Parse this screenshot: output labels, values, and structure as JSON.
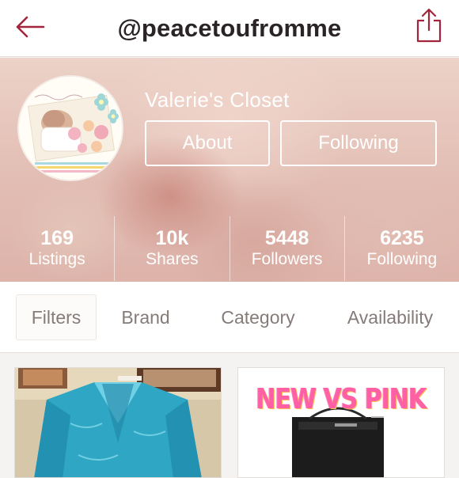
{
  "header": {
    "title": "@peacetoufromme",
    "back_icon": "back-arrow-icon",
    "share_icon": "share-icon"
  },
  "profile": {
    "closet_name": "Valerie's Closet",
    "about_label": "About",
    "following_label": "Following"
  },
  "stats": [
    {
      "value": "169",
      "label": "Listings"
    },
    {
      "value": "10k",
      "label": "Shares"
    },
    {
      "value": "5448",
      "label": "Followers"
    },
    {
      "value": "6235",
      "label": "Following"
    }
  ],
  "filters": [
    {
      "label": "Filters"
    },
    {
      "label": "Brand"
    },
    {
      "label": "Category"
    },
    {
      "label": "Availability"
    }
  ],
  "listings": [
    {
      "image": "teal-satin-robe-photo"
    },
    {
      "overlay_text": "NEW VS PINK",
      "image": "black-tote-bag-photo"
    }
  ],
  "colors": {
    "accent": "#a3253d",
    "title_text": "#2a2426",
    "banner": "#e2bdb3",
    "filter_text": "#857b79"
  }
}
